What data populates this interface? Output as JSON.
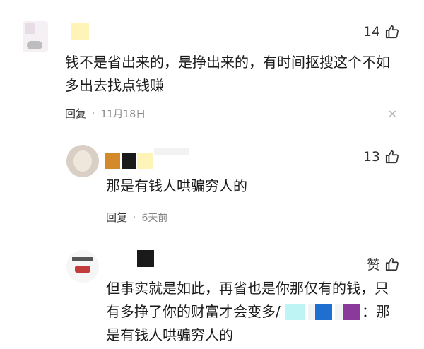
{
  "comments": [
    {
      "like_count": "14",
      "text_line1": "钱不是省出来的，是挣出来的，有时间抠搜这个不如",
      "text_line2": "多出去找点钱赚",
      "reply_label": "回复",
      "date": "11月18日"
    },
    {
      "like_count": "13",
      "text": "那是有钱人哄骗穷人的",
      "reply_label": "回复",
      "date": "6天前"
    },
    {
      "like_label": "赞",
      "text_line1": "但事实就是如此，再省也是你那仅有的钱，只",
      "text_line2a": "有多挣了你的财富才会变多/",
      "text_line2b": "：那",
      "text_line3": "是有钱人哄骗穷人的"
    }
  ],
  "icons": {
    "like": "thumbs-up-icon",
    "close": "close-icon"
  },
  "colors": {
    "mosaic_orange": "#d48a2a",
    "mosaic_black": "#1a1a1a",
    "mosaic_yellow": "#fff4b8",
    "mosaic_cyan": "#bff4f4",
    "mosaic_blue": "#1f6fd1",
    "mosaic_purple": "#8a3a9a"
  }
}
